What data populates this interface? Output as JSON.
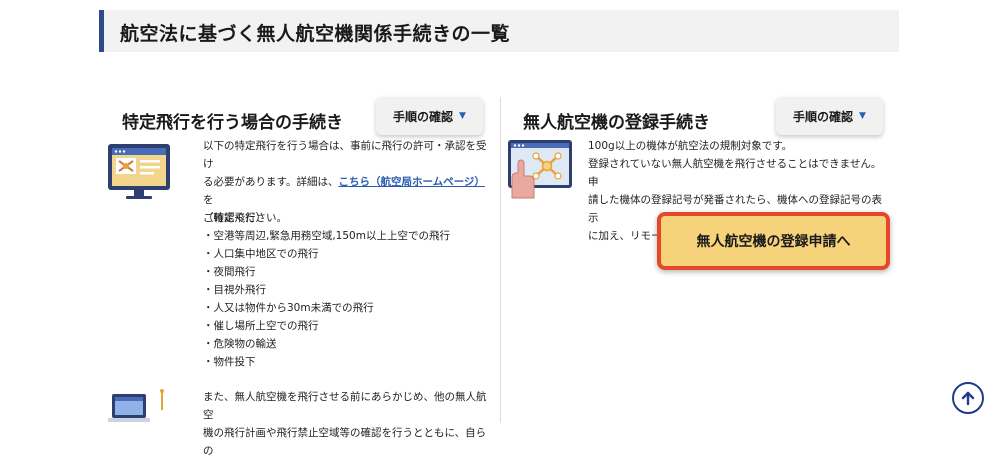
{
  "page": {
    "title": "航空法に基づく無人航空機関係手続きの一覧"
  },
  "left": {
    "heading": "特定飛行を行う場合の手続き",
    "step_button_label": "手順の確認",
    "intro_1": "以下の特定飛行を行う場合は、事前に飛行の許可・承認を受け",
    "intro_2": "る必要があります。詳細は、",
    "intro_link": "こちら（航空局ホームページ）",
    "intro_3": "を",
    "intro_4": "ご確認ください。",
    "list_heading": "（特定飛行）",
    "list_items": [
      "・空港等周辺,緊急用務空域,150m以上上空での飛行",
      "・人口集中地区での飛行",
      "・夜間飛行",
      "・目視外飛行",
      "・人又は物件から30m未満での飛行",
      "・催し場所上空での飛行",
      "・危険物の輸送",
      "・物件投下"
    ],
    "more_1": "また、無人航空機を飛行させる前にあらかじめ、他の無人航空",
    "more_2": "機の飛行計画や飛行禁止空域等の確認を行うとともに、自らの"
  },
  "right": {
    "heading": "無人航空機の登録手続き",
    "step_button_label": "手順の確認",
    "line_1": "100g以上の機体が航空法の規制対象です。",
    "line_2": "登録されていない無人航空機を飛行させることはできません。申",
    "line_3": "請した機体の登録記号が発番されたら、機体への登録記号の表示",
    "line_4": "に加え、リモートID機能を搭載しなければなりません。",
    "register_button_label": "無人航空機の登録申請へ"
  },
  "icons": {
    "caret": "caret-down-icon",
    "scroll_top": "arrow-up-circle-icon",
    "monitor_drone": "monitor-drone-illustration",
    "browser_drone": "browser-drone-touch-illustration",
    "laptop": "laptop-illustration"
  },
  "colors": {
    "accent_blue": "#2f4a8a",
    "register_fill": "#f6d27b",
    "register_border": "#e8462a",
    "link": "#2a5db0"
  }
}
